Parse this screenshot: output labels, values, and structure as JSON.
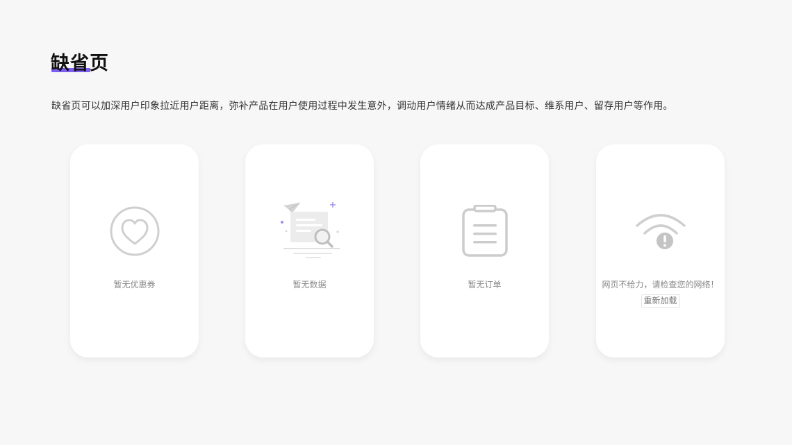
{
  "page": {
    "title": "缺省页",
    "description": "缺省页可以加深用户印象拉近用户距离，弥补产品在用户使用过程中发生意外，调动用户情绪从而达成产品目标、维系用户、留存用户等作用。",
    "accent_color": "#7d5ef0"
  },
  "cards": [
    {
      "icon": "heart-circle-icon",
      "message": "暂无优惠券"
    },
    {
      "icon": "document-search-icon",
      "message": "暂无数据"
    },
    {
      "icon": "clipboard-icon",
      "message": "暂无订单"
    },
    {
      "icon": "wifi-error-icon",
      "message": "网页不给力，请检查您的网络！",
      "action_label": "重新加载"
    }
  ]
}
